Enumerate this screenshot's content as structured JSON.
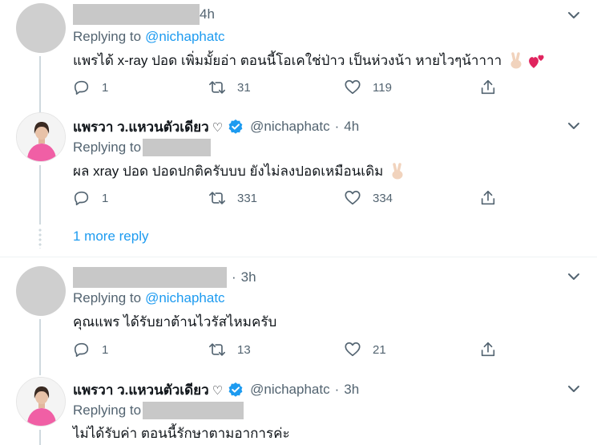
{
  "colors": {
    "accent": "#1d9bf0",
    "secondary_text": "#536471",
    "primary_text": "#0f1419",
    "redaction": "#c8c8c8"
  },
  "more_replies_label": "1 more reply",
  "tweets": [
    {
      "author_redacted": true,
      "time": "4h",
      "replying_label": "Replying to",
      "replying_to": "@nichaphatc",
      "text": "แพรได้ x-ray ปอด เพิ่มมั้ยอ่า ตอนนี้โอเคใช่ป่าว เป็นห่วงน้า หายไวๆน้าาาา",
      "emojis": [
        "victory-hand-emoji",
        "two-hearts-emoji"
      ],
      "replies": "1",
      "retweets": "31",
      "likes": "119"
    },
    {
      "author_name": "แพรวา ว.แหวนตัวเดียว",
      "author_heart": "♡",
      "handle": "@nichaphatc",
      "dot": "·",
      "time": "4h",
      "replying_label": "Replying to",
      "replying_redacted": true,
      "text": "ผล xray ปอด ปอดปกติครับบบ ยังไม่ลงปอดเหมือนเดิม",
      "emojis": [
        "victory-hand-emoji"
      ],
      "replies": "1",
      "retweets": "331",
      "likes": "334"
    },
    {
      "author_redacted": true,
      "dot": "·",
      "time": "3h",
      "replying_label": "Replying to",
      "replying_to": "@nichaphatc",
      "text": "คุณแพร ได้รับยาต้านไวรัสไหมครับ",
      "replies": "1",
      "retweets": "13",
      "likes": "21"
    },
    {
      "author_name": "แพรวา ว.แหวนตัวเดียว",
      "author_heart": "♡",
      "handle": "@nichaphatc",
      "dot": "·",
      "time": "3h",
      "replying_label": "Replying to",
      "replying_redacted": true,
      "text": "ไม่ได้รับค่า ตอนนี้รักษาตามอาการค่ะ"
    }
  ]
}
